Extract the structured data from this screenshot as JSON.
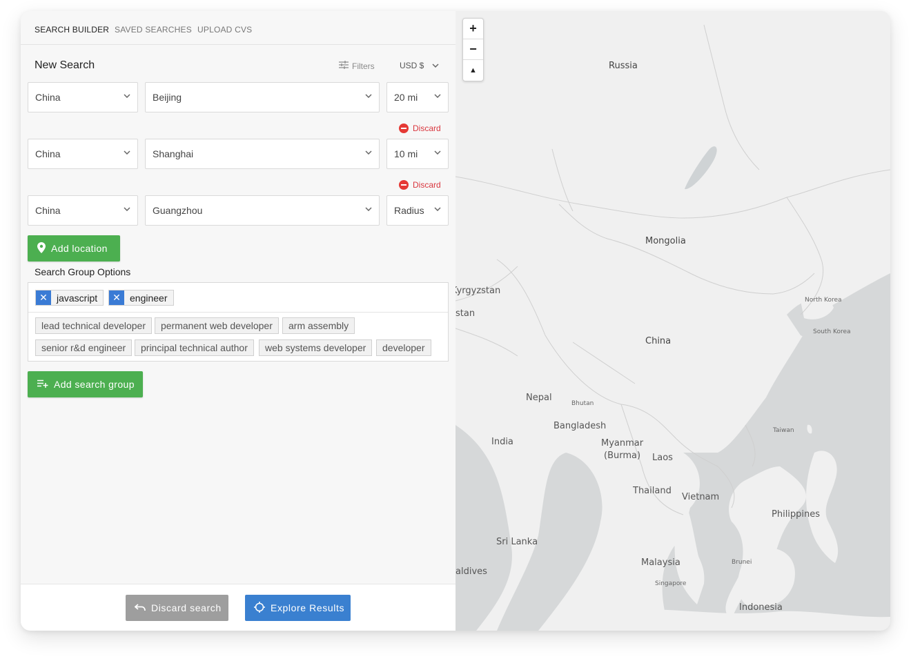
{
  "tabs": [
    "SEARCH BUILDER",
    "SAVED SEARCHES",
    "UPLOAD CVS"
  ],
  "header": {
    "title": "New Search",
    "filters_label": "Filters",
    "currency": "USD $"
  },
  "locations": [
    {
      "country": "China",
      "city": "Beijing",
      "radius": "20 mi"
    },
    {
      "country": "China",
      "city": "Shanghai",
      "radius": "10 mi"
    },
    {
      "country": "China",
      "city": "Guangzhou",
      "radius": "Radius"
    }
  ],
  "discard_label": "Discard",
  "add_location_label": "Add location",
  "search_group": {
    "label": "Search Group Options",
    "selected_tags": [
      "javascript",
      "engineer"
    ],
    "suggestions": [
      "lead technical developer",
      "permanent web developer",
      "arm assembly",
      "senior r&d engineer",
      "principal technical author",
      "web systems developer",
      "developer"
    ]
  },
  "add_search_group_label": "Add search group",
  "footer": {
    "discard_search_label": "Discard search",
    "explore_results_label": "Explore Results"
  },
  "map": {
    "zoom_in": "+",
    "zoom_out": "−",
    "compass": "▲",
    "labels": {
      "russia": "Russia",
      "mongolia": "Mongolia",
      "kyrgyzstan": "Kyrgyzstan",
      "stan": "stan",
      "china": "China",
      "north_korea": "North Korea",
      "south_korea": "South Korea",
      "nepal": "Nepal",
      "bhutan": "Bhutan",
      "bangladesh": "Bangladesh",
      "india": "India",
      "myanmar": "Myanmar\n(Burma)",
      "laos": "Laos",
      "taiwan": "Taiwan",
      "thailand": "Thailand",
      "vietnam": "Vietnam",
      "philippines": "Philippines",
      "sri_lanka": "Sri Lanka",
      "maldives": "aldives",
      "malaysia": "Malaysia",
      "brunei": "Brunei",
      "singapore": "Singapore",
      "indonesia": "Indonesia"
    }
  }
}
